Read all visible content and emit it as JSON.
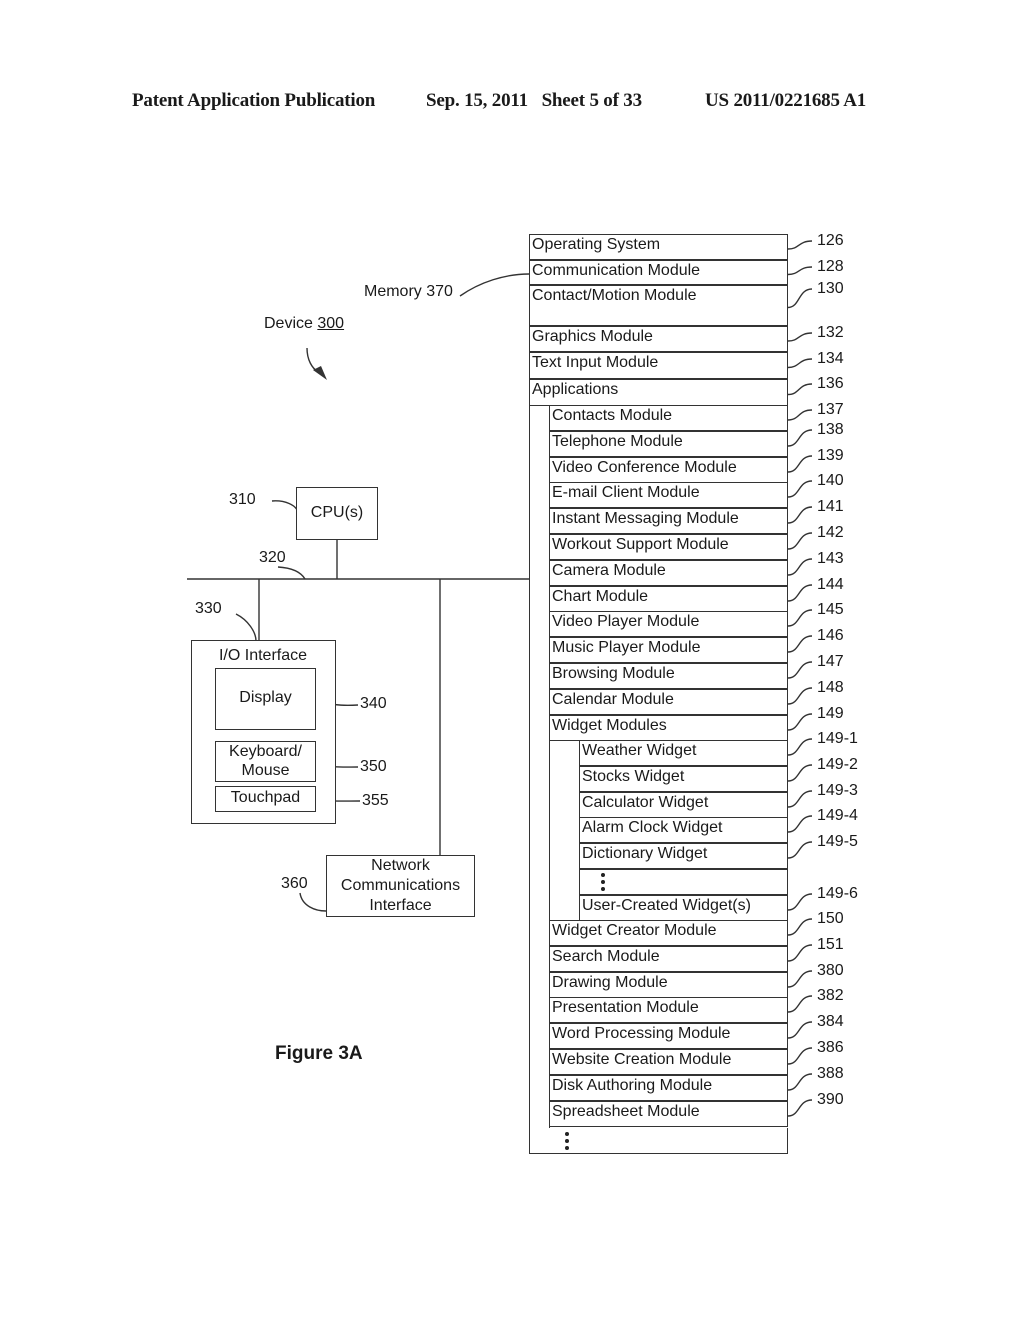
{
  "header": {
    "publication": "Patent Application Publication",
    "date_sheet": "Sep. 15, 2011   Sheet 5 of 33",
    "patent_number": "US 2011/0221685 A1"
  },
  "diagram": {
    "device_label": "Device",
    "device_ref": "300",
    "memory_label": "Memory 370",
    "cpu": {
      "label": "CPU(s)",
      "ref": "310"
    },
    "bus_ref": "320",
    "io": {
      "label": "I/O Interface",
      "ref": "330"
    },
    "display": {
      "label": "Display",
      "ref": "340"
    },
    "keyboard": {
      "label_line1": "Keyboard/",
      "label_line2": "Mouse",
      "ref": "350"
    },
    "touchpad": {
      "label": "Touchpad",
      "ref": "355"
    },
    "network": {
      "line1": "Network",
      "line2": "Communications",
      "line3": "Interface",
      "ref": "360"
    },
    "figure_label": "Figure 3A",
    "memory_modules": [
      {
        "label": "Operating System",
        "ref": "126"
      },
      {
        "label": "Communication Module",
        "ref": "128"
      },
      {
        "label": "Contact/Motion Module",
        "ref": "130"
      },
      {
        "label": "Graphics Module",
        "ref": "132"
      },
      {
        "label": "Text Input Module",
        "ref": "134"
      },
      {
        "label": "Applications",
        "ref": "136"
      }
    ],
    "applications": [
      {
        "label": "Contacts Module",
        "ref": "137"
      },
      {
        "label": "Telephone Module",
        "ref": "138"
      },
      {
        "label": "Video Conference Module",
        "ref": "139"
      },
      {
        "label": "E-mail Client Module",
        "ref": "140"
      },
      {
        "label": "Instant Messaging Module",
        "ref": "141"
      },
      {
        "label": "Workout Support Module",
        "ref": "142"
      },
      {
        "label": "Camera Module",
        "ref": "143"
      },
      {
        "label": "Chart Module",
        "ref": "144"
      },
      {
        "label": "Video Player Module",
        "ref": "145"
      },
      {
        "label": "Music Player Module",
        "ref": "146"
      },
      {
        "label": "Browsing Module",
        "ref": "147"
      },
      {
        "label": "Calendar Module",
        "ref": "148"
      },
      {
        "label": "Widget Modules",
        "ref": "149"
      }
    ],
    "widgets": [
      {
        "label": "Weather Widget",
        "ref": "149-1"
      },
      {
        "label": "Stocks Widget",
        "ref": "149-2"
      },
      {
        "label": "Calculator Widget",
        "ref": "149-3"
      },
      {
        "label": "Alarm Clock Widget",
        "ref": "149-4"
      },
      {
        "label": "Dictionary Widget",
        "ref": "149-5"
      },
      {
        "label": "User-Created Widget(s)",
        "ref": "149-6"
      }
    ],
    "more_applications": [
      {
        "label": "Widget Creator Module",
        "ref": "150"
      },
      {
        "label": "Search Module",
        "ref": "151"
      },
      {
        "label": "Drawing Module",
        "ref": "380"
      },
      {
        "label": "Presentation Module",
        "ref": "382"
      },
      {
        "label": "Word Processing  Module",
        "ref": "384"
      },
      {
        "label": "Website Creation Module",
        "ref": "386"
      },
      {
        "label": "Disk Authoring Module",
        "ref": "388"
      },
      {
        "label": "Spreadsheet Module",
        "ref": "390"
      }
    ]
  }
}
